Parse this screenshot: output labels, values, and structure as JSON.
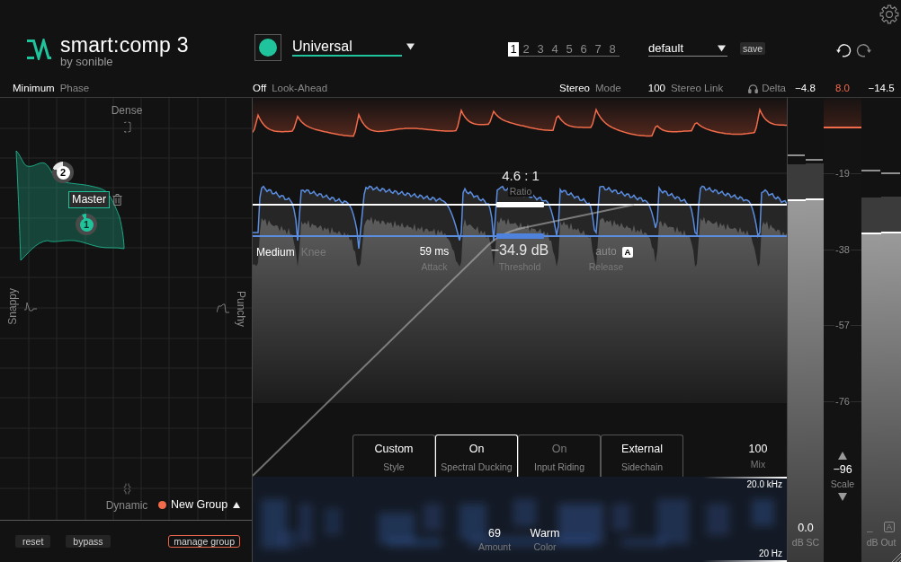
{
  "logo": {
    "title": "smart:comp 3",
    "subtitle": "by sonible"
  },
  "profile": {
    "value": "Universal"
  },
  "preset_slots": [
    {
      "label": "1",
      "selected": true
    },
    {
      "label": "2",
      "selected": false
    },
    {
      "label": "3",
      "selected": false
    },
    {
      "label": "4",
      "selected": false
    },
    {
      "label": "5",
      "selected": false
    },
    {
      "label": "6",
      "selected": false
    },
    {
      "label": "7",
      "selected": false
    },
    {
      "label": "8",
      "selected": false
    }
  ],
  "preset": {
    "value": "default",
    "save": "save"
  },
  "settings": [
    {
      "value": "Minimum",
      "label": "Phase"
    },
    {
      "value": "Off",
      "label": "Look-Ahead"
    },
    {
      "value": "Stereo",
      "label": "Mode"
    },
    {
      "value": "100",
      "label": "Stereo Link"
    }
  ],
  "delta": {
    "label": "Delta",
    "on": false
  },
  "meter_readings": [
    {
      "value": "−4.8",
      "color": "#ffffff"
    },
    {
      "value": "8.0",
      "color": "#f26b4a"
    },
    {
      "value": "−14.5",
      "color": "#ffffff"
    }
  ],
  "style_map": {
    "axes": {
      "top": "Dense",
      "left": "Snappy",
      "right": "Punchy",
      "bottom": "Dynamic"
    },
    "nodes": [
      {
        "label": "2",
        "selected": false
      },
      {
        "label": "1",
        "selected": true
      }
    ],
    "node_tag": "Master",
    "group": "New Group"
  },
  "footer_buttons": [
    {
      "label": "reset",
      "kind": "plain"
    },
    {
      "label": "bypass",
      "kind": "plain"
    },
    {
      "label": "manage group",
      "kind": "outlined"
    }
  ],
  "graph": {
    "ratio": {
      "value": "4.6 : 1",
      "label": "Ratio"
    },
    "knee": {
      "value": "Medium",
      "label": "Knee"
    },
    "attack": {
      "value": "59 ms",
      "label": "Attack"
    },
    "threshold": {
      "value": "−34.9 dB",
      "label": "Threshold"
    },
    "release": {
      "value": "auto",
      "label": "Release",
      "badge": {
        "text": "A",
        "on": true
      }
    }
  },
  "modes": [
    {
      "value": "Custom",
      "label": "Style",
      "selected": false,
      "disabled": false
    },
    {
      "value": "On",
      "label": "Spectral Ducking",
      "selected": true,
      "disabled": false
    },
    {
      "value": "On",
      "label": "Input Riding",
      "selected": false,
      "disabled": true
    },
    {
      "value": "External",
      "label": "Sidechain",
      "selected": false,
      "disabled": false
    }
  ],
  "mix": {
    "value": "100",
    "label": "Mix"
  },
  "spectrum": {
    "top_label": "20.0 kHz",
    "bottom_label": "20 Hz",
    "controls": [
      {
        "value": "69",
        "label": "Amount"
      },
      {
        "value": "Warm",
        "label": "Color"
      }
    ]
  },
  "meters": {
    "sidechain": {
      "channels": [
        {
          "level": 0.781,
          "peak": {
            "level": 0.857
          },
          "hold": {
            "level": 0.874
          }
        },
        {
          "level": 0.783,
          "peak": {
            "level": 0.859
          },
          "hold": {
            "level": 0.865
          }
        }
      ],
      "value": "0.0",
      "label": "dB SC"
    },
    "gain_reduction": {
      "level": 0.066
    },
    "scale": {
      "labels": [
        "-19",
        "-38",
        "-57",
        "-76"
      ],
      "value": "−96",
      "label": "Scale"
    },
    "output": {
      "channels": [
        {
          "level": 0.71,
          "peak": {
            "level": 0.785
          },
          "hold": {
            "level": 0.841
          }
        },
        {
          "level": 0.712,
          "peak": {
            "level": 0.787
          },
          "hold": {
            "level": 0.836
          }
        }
      ],
      "value": "–",
      "label": "dB Out",
      "badge": {
        "text": "A",
        "on": false
      }
    }
  }
}
